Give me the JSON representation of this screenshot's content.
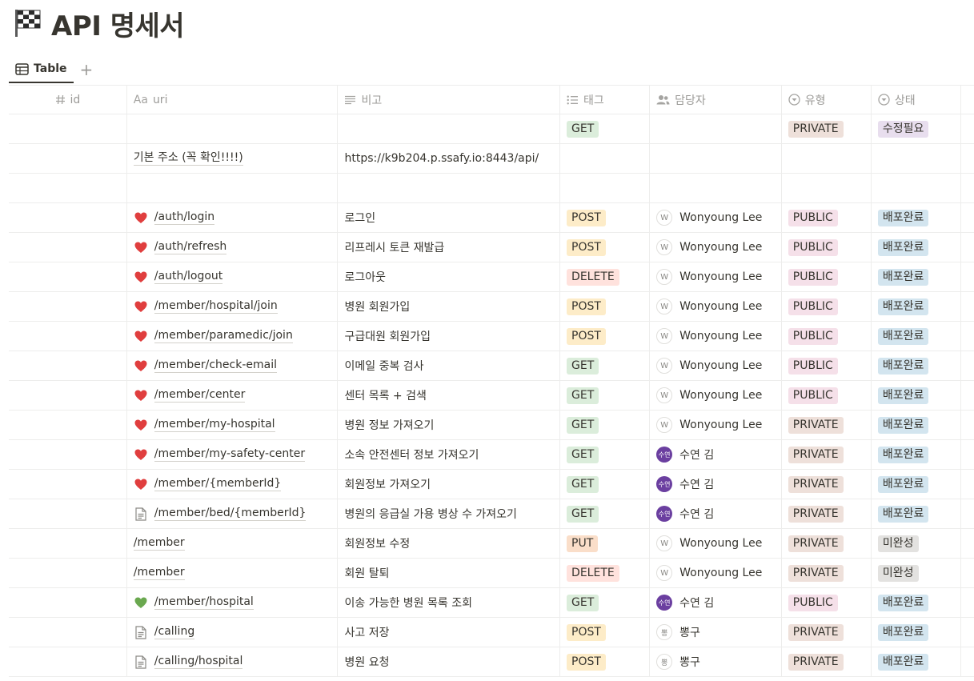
{
  "page": {
    "title": "API 명세서"
  },
  "views": {
    "tab_label": "Table",
    "add_label": "+"
  },
  "headers": {
    "id": "id",
    "uri": "uri",
    "note": "비고",
    "tag": "태그",
    "assignee": "담당자",
    "type": "유형",
    "status": "상태",
    "uri_prefix": "Aa"
  },
  "colors": {
    "GET": "#dbeddb",
    "POST": "#fdecc8",
    "DELETE": "#ffe2dd",
    "PUT": "#fadec9",
    "PUBLIC": "#f5e0e9",
    "PRIVATE": "#eee0da",
    "배포완료": "#d3e5ef",
    "미완성": "#e3e2e0",
    "수정필요": "#e8deee",
    "heart_red": "#e03e3e",
    "heart_green": "#6aa84f"
  },
  "rows": [
    {
      "id": "",
      "icon": "none",
      "uri": "",
      "note": "",
      "tag": "GET",
      "assignee": "",
      "avatar": "",
      "avatar_kind": "none",
      "type": "PRIVATE",
      "status": "수정필요"
    },
    {
      "id": "",
      "icon": "none",
      "uri": "기본 주소 (꼭 확인!!!!)",
      "note": "https://k9b204.p.ssafy.io:8443/api/",
      "tag": "",
      "assignee": "",
      "avatar": "",
      "avatar_kind": "none",
      "type": "",
      "status": ""
    },
    {
      "id": "",
      "icon": "none",
      "uri": "",
      "note": "",
      "tag": "",
      "assignee": "",
      "avatar": "",
      "avatar_kind": "none",
      "type": "",
      "status": ""
    },
    {
      "id": "",
      "icon": "heart-red",
      "uri": "/auth/login",
      "note": "로그인",
      "tag": "POST",
      "assignee": "Wonyoung Lee",
      "avatar": "W",
      "avatar_kind": "w",
      "type": "PUBLIC",
      "status": "배포완료"
    },
    {
      "id": "",
      "icon": "heart-red",
      "uri": "/auth/refresh",
      "note": "리프레시 토큰 재발급",
      "tag": "POST",
      "assignee": "Wonyoung Lee",
      "avatar": "W",
      "avatar_kind": "w",
      "type": "PUBLIC",
      "status": "배포완료"
    },
    {
      "id": "",
      "icon": "heart-red",
      "uri": "/auth/logout",
      "note": "로그아웃",
      "tag": "DELETE",
      "assignee": "Wonyoung Lee",
      "avatar": "W",
      "avatar_kind": "w",
      "type": "PUBLIC",
      "status": "배포완료"
    },
    {
      "id": "",
      "icon": "heart-red",
      "uri": "/member/hospital/join",
      "note": "병원 회원가입",
      "tag": "POST",
      "assignee": "Wonyoung Lee",
      "avatar": "W",
      "avatar_kind": "w",
      "type": "PUBLIC",
      "status": "배포완료"
    },
    {
      "id": "",
      "icon": "heart-red",
      "uri": "/member/paramedic/join",
      "note": "구급대원 회원가입",
      "tag": "POST",
      "assignee": "Wonyoung Lee",
      "avatar": "W",
      "avatar_kind": "w",
      "type": "PUBLIC",
      "status": "배포완료"
    },
    {
      "id": "",
      "icon": "heart-red",
      "uri": "/member/check-email",
      "note": "이메일 중복 검사",
      "tag": "GET",
      "assignee": "Wonyoung Lee",
      "avatar": "W",
      "avatar_kind": "w",
      "type": "PUBLIC",
      "status": "배포완료"
    },
    {
      "id": "",
      "icon": "heart-red",
      "uri": "/member/center",
      "note": "센터 목록 + 검색",
      "tag": "GET",
      "assignee": "Wonyoung Lee",
      "avatar": "W",
      "avatar_kind": "w",
      "type": "PUBLIC",
      "status": "배포완료"
    },
    {
      "id": "",
      "icon": "heart-red",
      "uri": "/member/my-hospital",
      "note": "병원 정보 가져오기",
      "tag": "GET",
      "assignee": "Wonyoung Lee",
      "avatar": "W",
      "avatar_kind": "w",
      "type": "PRIVATE",
      "status": "배포완료"
    },
    {
      "id": "",
      "icon": "heart-red",
      "uri": "/member/my-safety-center",
      "note": "소속 안전센터 정보 가져오기",
      "tag": "GET",
      "assignee": "수연 김",
      "avatar": "수연",
      "avatar_kind": "s",
      "type": "PRIVATE",
      "status": "배포완료"
    },
    {
      "id": "",
      "icon": "heart-red",
      "uri": "/member/{memberId}",
      "note": "회원정보 가져오기",
      "tag": "GET",
      "assignee": "수연 김",
      "avatar": "수연",
      "avatar_kind": "s",
      "type": "PRIVATE",
      "status": "배포완료"
    },
    {
      "id": "",
      "icon": "page",
      "uri": "/member/bed/{memberId}",
      "note": "병원의 응급실 가용 병상 수 가져오기",
      "tag": "GET",
      "assignee": "수연 김",
      "avatar": "수연",
      "avatar_kind": "s",
      "type": "PRIVATE",
      "status": "배포완료"
    },
    {
      "id": "",
      "icon": "none",
      "uri": "/member",
      "note": "회원정보 수정",
      "tag": "PUT",
      "assignee": "Wonyoung Lee",
      "avatar": "W",
      "avatar_kind": "w",
      "type": "PRIVATE",
      "status": "미완성"
    },
    {
      "id": "",
      "icon": "none",
      "uri": "/member",
      "note": "회원 탈퇴",
      "tag": "DELETE",
      "assignee": "Wonyoung Lee",
      "avatar": "W",
      "avatar_kind": "w",
      "type": "PRIVATE",
      "status": "미완성"
    },
    {
      "id": "",
      "icon": "heart-green",
      "uri": "/member/hospital",
      "note": "이송 가능한 병원 목록 조회",
      "tag": "GET",
      "assignee": "수연 김",
      "avatar": "수연",
      "avatar_kind": "s",
      "type": "PUBLIC",
      "status": "배포완료"
    },
    {
      "id": "",
      "icon": "page",
      "uri": "/calling",
      "note": "사고 저장",
      "tag": "POST",
      "assignee": "뽕구",
      "avatar": "뽕",
      "avatar_kind": "b",
      "type": "PRIVATE",
      "status": "배포완료"
    },
    {
      "id": "",
      "icon": "page",
      "uri": "/calling/hospital",
      "note": "병원 요청",
      "tag": "POST",
      "assignee": "뽕구",
      "avatar": "뽕",
      "avatar_kind": "b",
      "type": "PRIVATE",
      "status": "배포완료"
    }
  ]
}
